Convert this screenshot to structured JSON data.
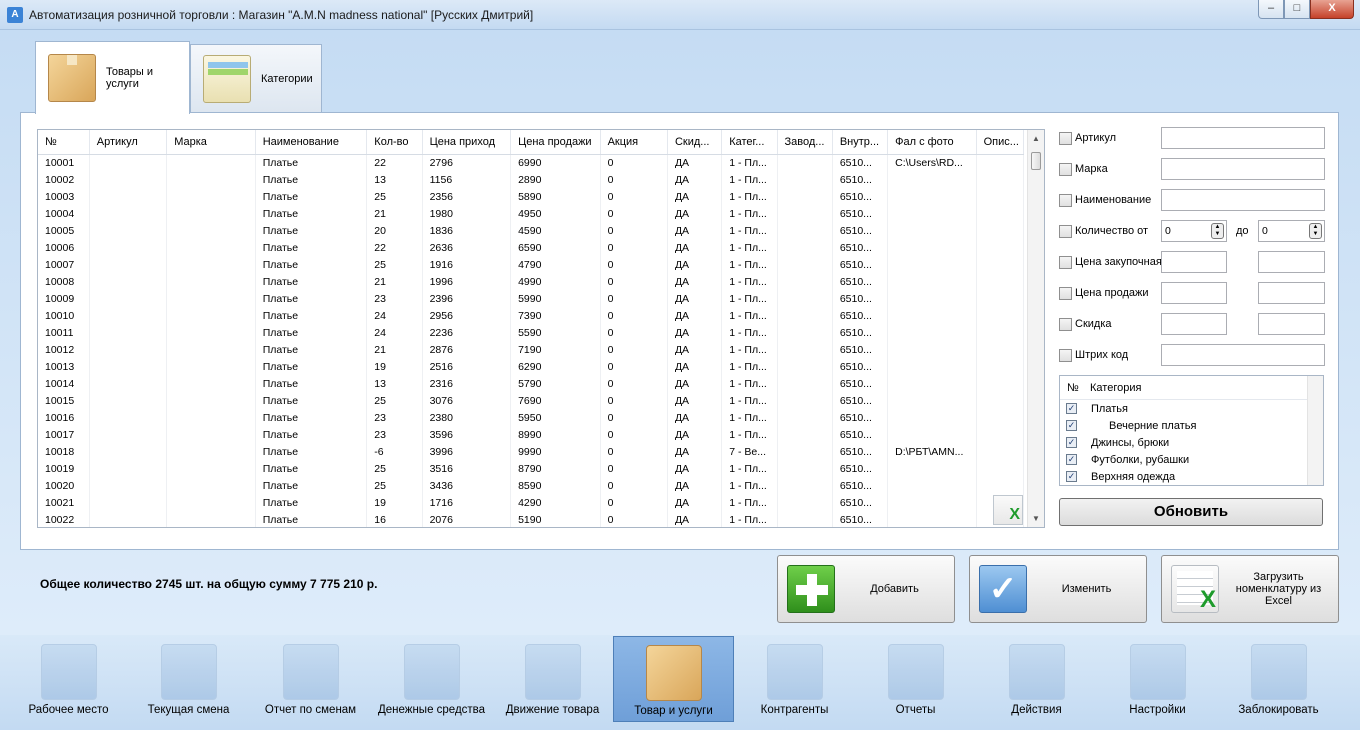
{
  "window": {
    "title": "Автоматизация розничной торговли : Магазин \"A.M.N madness national\" [Русских Дмитрий]",
    "app_icon": "A",
    "min": "–",
    "max": "□",
    "close": "X"
  },
  "tabs": [
    {
      "label": "Товары и услуги",
      "icon": "box-icon",
      "active": true
    },
    {
      "label": "Категории",
      "icon": "folder-icon",
      "active": false
    }
  ],
  "grid": {
    "columns": [
      "№",
      "Артикул",
      "Марка",
      "Наименование",
      "Кол-во",
      "Цена приход",
      "Цена продажи",
      "Акция",
      "Скид...",
      "Катег...",
      "Завод...",
      "Внутр...",
      "Фал с фото",
      "Опис..."
    ],
    "rows": [
      [
        "10001",
        "",
        "",
        "Платье",
        "22",
        "2796",
        "6990",
        "0",
        "ДА",
        "1 - Пл...",
        "",
        "6510...",
        "C:\\Users\\RD...",
        ""
      ],
      [
        "10002",
        "",
        "",
        "Платье",
        "13",
        "1156",
        "2890",
        "0",
        "ДА",
        "1 - Пл...",
        "",
        "6510...",
        "",
        ""
      ],
      [
        "10003",
        "",
        "",
        "Платье",
        "25",
        "2356",
        "5890",
        "0",
        "ДА",
        "1 - Пл...",
        "",
        "6510...",
        "",
        ""
      ],
      [
        "10004",
        "",
        "",
        "Платье",
        "21",
        "1980",
        "4950",
        "0",
        "ДА",
        "1 - Пл...",
        "",
        "6510...",
        "",
        ""
      ],
      [
        "10005",
        "",
        "",
        "Платье",
        "20",
        "1836",
        "4590",
        "0",
        "ДА",
        "1 - Пл...",
        "",
        "6510...",
        "",
        ""
      ],
      [
        "10006",
        "",
        "",
        "Платье",
        "22",
        "2636",
        "6590",
        "0",
        "ДА",
        "1 - Пл...",
        "",
        "6510...",
        "",
        ""
      ],
      [
        "10007",
        "",
        "",
        "Платье",
        "25",
        "1916",
        "4790",
        "0",
        "ДА",
        "1 - Пл...",
        "",
        "6510...",
        "",
        ""
      ],
      [
        "10008",
        "",
        "",
        "Платье",
        "21",
        "1996",
        "4990",
        "0",
        "ДА",
        "1 - Пл...",
        "",
        "6510...",
        "",
        ""
      ],
      [
        "10009",
        "",
        "",
        "Платье",
        "23",
        "2396",
        "5990",
        "0",
        "ДА",
        "1 - Пл...",
        "",
        "6510...",
        "",
        ""
      ],
      [
        "10010",
        "",
        "",
        "Платье",
        "24",
        "2956",
        "7390",
        "0",
        "ДА",
        "1 - Пл...",
        "",
        "6510...",
        "",
        ""
      ],
      [
        "10011",
        "",
        "",
        "Платье",
        "24",
        "2236",
        "5590",
        "0",
        "ДА",
        "1 - Пл...",
        "",
        "6510...",
        "",
        ""
      ],
      [
        "10012",
        "",
        "",
        "Платье",
        "21",
        "2876",
        "7190",
        "0",
        "ДА",
        "1 - Пл...",
        "",
        "6510...",
        "",
        ""
      ],
      [
        "10013",
        "",
        "",
        "Платье",
        "19",
        "2516",
        "6290",
        "0",
        "ДА",
        "1 - Пл...",
        "",
        "6510...",
        "",
        ""
      ],
      [
        "10014",
        "",
        "",
        "Платье",
        "13",
        "2316",
        "5790",
        "0",
        "ДА",
        "1 - Пл...",
        "",
        "6510...",
        "",
        ""
      ],
      [
        "10015",
        "",
        "",
        "Платье",
        "25",
        "3076",
        "7690",
        "0",
        "ДА",
        "1 - Пл...",
        "",
        "6510...",
        "",
        ""
      ],
      [
        "10016",
        "",
        "",
        "Платье",
        "23",
        "2380",
        "5950",
        "0",
        "ДА",
        "1 - Пл...",
        "",
        "6510...",
        "",
        ""
      ],
      [
        "10017",
        "",
        "",
        "Платье",
        "23",
        "3596",
        "8990",
        "0",
        "ДА",
        "1 - Пл...",
        "",
        "6510...",
        "",
        ""
      ],
      [
        "10018",
        "",
        "",
        "Платье",
        "-6",
        "3996",
        "9990",
        "0",
        "ДА",
        "7 - Ве...",
        "",
        "6510...",
        "D:\\РБТ\\AMN...",
        ""
      ],
      [
        "10019",
        "",
        "",
        "Платье",
        "25",
        "3516",
        "8790",
        "0",
        "ДА",
        "1 - Пл...",
        "",
        "6510...",
        "",
        ""
      ],
      [
        "10020",
        "",
        "",
        "Платье",
        "25",
        "3436",
        "8590",
        "0",
        "ДА",
        "1 - Пл...",
        "",
        "6510...",
        "",
        ""
      ],
      [
        "10021",
        "",
        "",
        "Платье",
        "19",
        "1716",
        "4290",
        "0",
        "ДА",
        "1 - Пл...",
        "",
        "6510...",
        "",
        ""
      ],
      [
        "10022",
        "",
        "",
        "Платье",
        "16",
        "2076",
        "5190",
        "0",
        "ДА",
        "1 - Пл...",
        "",
        "6510...",
        "",
        ""
      ]
    ]
  },
  "filters": {
    "article": "Артикул",
    "brand": "Марка",
    "name": "Наименование",
    "qty_from": "Количество от",
    "qty_from_value": "0",
    "qty_to_label": "до",
    "qty_to_value": "0",
    "buy_price": "Цена закупочная",
    "sell_price": "Цена продажи",
    "discount": "Скидка",
    "barcode": "Штрих код"
  },
  "categories": {
    "header_no": "№",
    "header_name": "Категория",
    "items": [
      "Платья",
      "Вечерние платья",
      "Джинсы, брюки",
      "Футболки, рубашки",
      "Верхняя одежда"
    ]
  },
  "update_button": "Обновить",
  "summary": "Общее количество 2745 шт. на общую сумму   7 775 210 р.",
  "actions": {
    "add": "Добавить",
    "edit": "Изменить",
    "import": "Загрузить номенклатуру из Excel"
  },
  "nav": [
    {
      "label": "Рабочее место",
      "icon": "cash-register-icon"
    },
    {
      "label": "Текущая смена",
      "icon": "notepad-pencil-icon"
    },
    {
      "label": "Отчет по сменам",
      "icon": "book-icon"
    },
    {
      "label": "Денежные средства",
      "icon": "safe-icon"
    },
    {
      "label": "Движение товара",
      "icon": "document-icon"
    },
    {
      "label": "Товар и услуги",
      "icon": "box-icon"
    },
    {
      "label": "Контрагенты",
      "icon": "phonebook-icon"
    },
    {
      "label": "Отчеты",
      "icon": "inbox-icon"
    },
    {
      "label": "Действия",
      "icon": "ruler-pencil-icon"
    },
    {
      "label": "Настройки",
      "icon": "settings-grid-icon"
    },
    {
      "label": "Заблокировать",
      "icon": "keyhole-icon"
    }
  ]
}
